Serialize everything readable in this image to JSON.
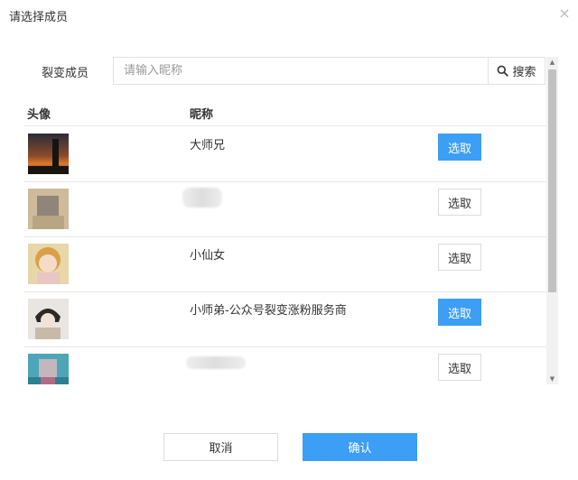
{
  "dialog": {
    "title": "请选择成员",
    "close_icon": "×"
  },
  "search": {
    "label": "裂变成员",
    "placeholder": "请输入昵称",
    "value": "",
    "button_label": "搜索"
  },
  "table": {
    "headers": {
      "avatar": "头像",
      "nickname": "昵称"
    },
    "rows": [
      {
        "nickname": "大师兄",
        "action": "选取",
        "selected": true
      },
      {
        "nickname": "",
        "action": "选取",
        "selected": false
      },
      {
        "nickname": "小仙女",
        "action": "选取",
        "selected": false
      },
      {
        "nickname": "小师弟-公众号裂变涨粉服务商",
        "action": "选取",
        "selected": true
      },
      {
        "nickname": "",
        "action": "选取",
        "selected": false
      }
    ]
  },
  "footer": {
    "cancel_label": "取消",
    "confirm_label": "确认"
  },
  "colors": {
    "primary": "#3c9ef4",
    "border": "#e2e2e2"
  }
}
